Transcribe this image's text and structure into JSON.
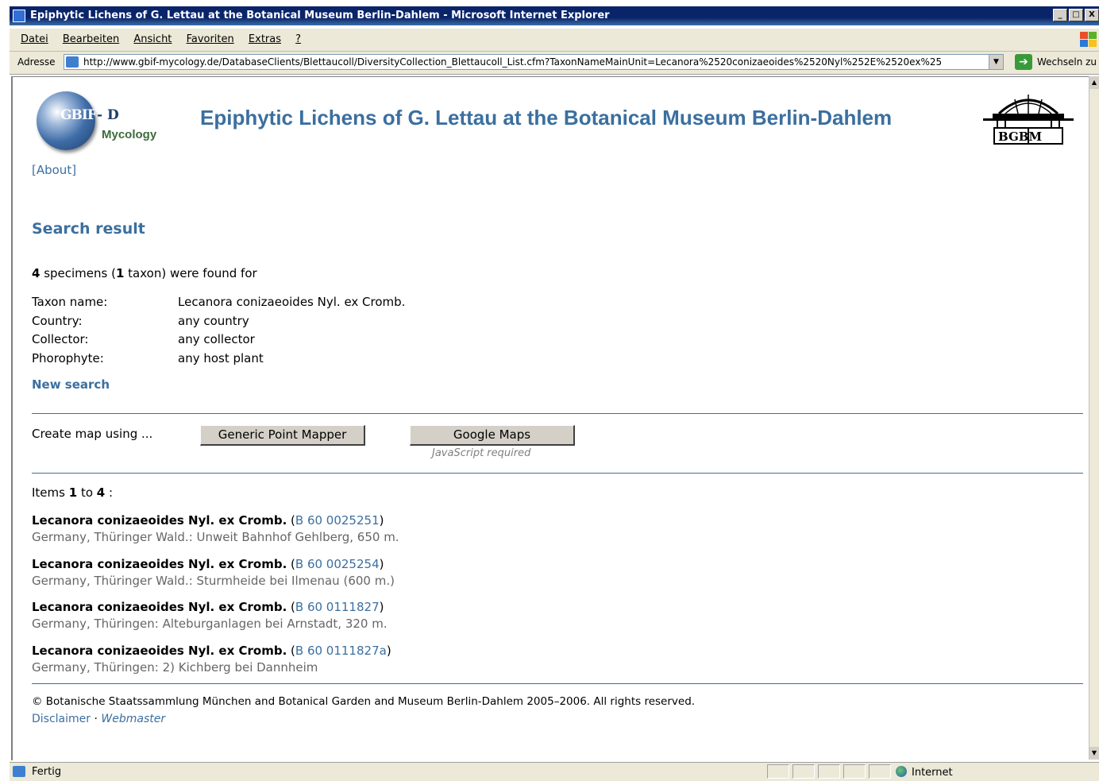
{
  "window": {
    "title": "Epiphytic Lichens of G. Lettau at the Botanical Museum Berlin-Dahlem - Microsoft Internet Explorer",
    "controls": [
      "_",
      "□",
      "X"
    ]
  },
  "menu": [
    "Datei",
    "Bearbeiten",
    "Ansicht",
    "Favoriten",
    "Extras",
    "?"
  ],
  "address_bar": {
    "label": "Adresse",
    "url": "http://www.gbif-mycology.de/DatabaseClients/Blettaucoll/DiversityCollection_Blettaucoll_List.cfm?TaxonNameMainUnit=Lecanora%2520conizaeoides%2520Nyl%252E%2520ex%25",
    "go_label": "Wechseln zu"
  },
  "page": {
    "logo_left": {
      "globe_text": "GBIF",
      "suffix": "- D",
      "sub": "Mycology"
    },
    "logo_right": "BGBM",
    "title": "Epiphytic Lichens of G. Lettau at the Botanical Museum Berlin-Dahlem",
    "about_link": "[About]",
    "heading": "Search result",
    "found": {
      "specimens": "4",
      "specimens_text": " specimens (",
      "taxa": "1",
      "taxa_text": " taxon) were found for"
    },
    "criteria": [
      {
        "label": "Taxon name:",
        "value": "Lecanora conizaeoides Nyl. ex Cromb."
      },
      {
        "label": "Country:",
        "value": "any country"
      },
      {
        "label": "Collector:",
        "value": "any collector"
      },
      {
        "label": "Phorophyte:",
        "value": "any host plant"
      }
    ],
    "new_search": "New search",
    "map": {
      "label": "Create map using ...",
      "btn_generic": "Generic Point Mapper",
      "btn_google": "Google Maps",
      "js_note": "JavaScript required"
    },
    "items_header": {
      "prefix": "Items ",
      "from": "1",
      "to_text": " to ",
      "to": "4",
      "suffix": " :"
    },
    "records": [
      {
        "name": "Lecanora conizaeoides Nyl. ex Cromb.",
        "accession": "B 60 0025251",
        "locality": "Germany, Thüringer Wald.: Unweit Bahnhof Gehlberg, 650 m."
      },
      {
        "name": "Lecanora conizaeoides Nyl. ex Cromb.",
        "accession": "B 60 0025254",
        "locality": "Germany, Thüringer Wald.: Sturmheide bei Ilmenau (600 m.)"
      },
      {
        "name": "Lecanora conizaeoides Nyl. ex Cromb.",
        "accession": "B 60 0111827",
        "locality": "Germany, Thüringen: Alteburganlagen bei Arnstadt, 320 m."
      },
      {
        "name": "Lecanora conizaeoides Nyl. ex Cromb.",
        "accession": "B 60 0111827a",
        "locality": "Germany, Thüringen: 2) Kichberg bei Dannheim"
      }
    ],
    "footer": {
      "copyright": "© Botanische Staatssammlung München and Botanical Garden and Museum Berlin-Dahlem 2005–2006. All rights reserved.",
      "disclaimer": "Disclaimer",
      "separator": " · ",
      "webmaster": "Webmaster"
    }
  },
  "status_bar": {
    "text": "Fertig",
    "zone": "Internet"
  },
  "colors": {
    "link": "#3b6f9f",
    "title_bar": "#0a246a",
    "chrome": "#ece9d8"
  }
}
